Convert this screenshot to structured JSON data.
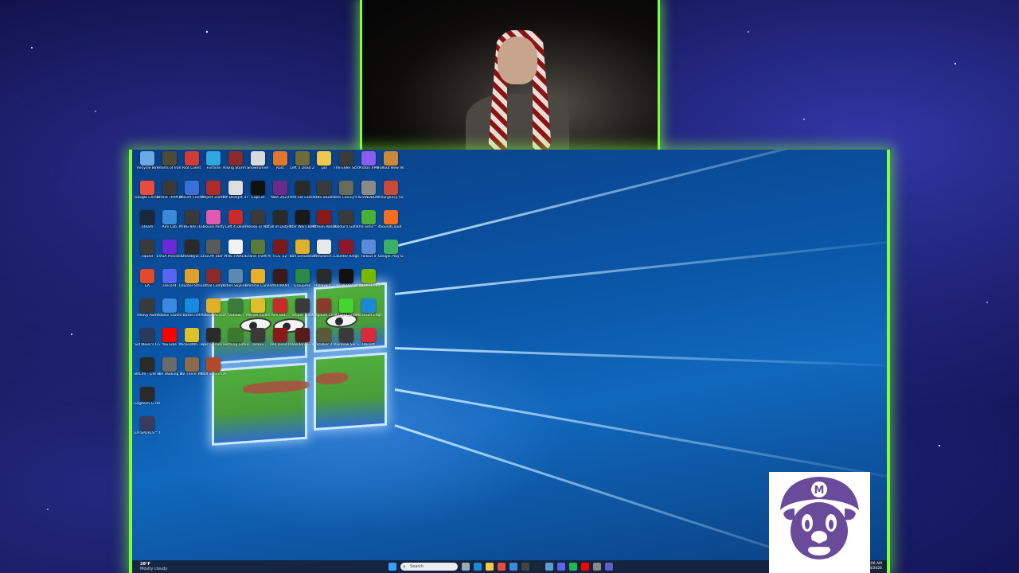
{
  "desktop_icons": [
    {
      "label": "Recycle Bin",
      "color": "#6aa8e6"
    },
    {
      "label": "Hearts of Iron IV",
      "color": "#4d4a3a"
    },
    {
      "label": "Riot Client",
      "color": "#d13b3b"
    },
    {
      "label": "Fortnite",
      "color": "#2ea7e0"
    },
    {
      "label": "Rising Storm 2 Vietnam",
      "color": "#8a2a2a"
    },
    {
      "label": "Snowrunner",
      "color": "#d9d9d9"
    },
    {
      "label": "Rust",
      "color": "#e0772c"
    },
    {
      "label": "Left 4 Dead 2",
      "color": "#6f6a3a"
    },
    {
      "label": "pol",
      "color": "#f0c94a"
    },
    {
      "label": "The Elder Scrolls ...",
      "color": "#3b3b3b"
    },
    {
      "label": "Proton VPN",
      "color": "#8a5cf0"
    },
    {
      "label": "Fallout New Vegas",
      "color": "#c98b3a"
    },
    {
      "label": "Google Chrome",
      "color": "#e74c3c"
    },
    {
      "label": "Grand Theft Auto IV T...",
      "color": "#3a3a3a"
    },
    {
      "label": "Ubisoft Connect",
      "color": "#3a6fd8"
    },
    {
      "label": "Project Zomboid",
      "color": "#b02a2a"
    },
    {
      "label": "HP DeskJet 3700 series",
      "color": "#dddddd"
    },
    {
      "label": "CapCut",
      "color": "#111111"
    },
    {
      "label": "NBA 2K23",
      "color": "#6a2a8a"
    },
    {
      "label": "Hell Let Loose",
      "color": "#2a2a2a"
    },
    {
      "label": "OBS Studio",
      "color": "#3a3a3a"
    },
    {
      "label": "Tom Clancy's Rainbow Si...",
      "color": "#6a6a5a"
    },
    {
      "label": "STANDBOX",
      "color": "#8a8a8a"
    },
    {
      "label": "Insurgency Sandstorm",
      "color": "#c94a3a"
    },
    {
      "label": "Steam",
      "color": "#1b2838"
    },
    {
      "label": "Aim Lab",
      "color": "#3a8ad8"
    },
    {
      "label": "PUBG BATTLEGR...",
      "color": "#3a3a3a"
    },
    {
      "label": "House Party",
      "color": "#e05ab0"
    },
    {
      "label": "Left 4 Dead",
      "color": "#c92a2a"
    },
    {
      "label": "Ready or Not",
      "color": "#3a3a3a"
    },
    {
      "label": "Call of Duty® M...",
      "color": "#2a2a2a"
    },
    {
      "label": "Star Wars Battlefront...",
      "color": "#1a1a1a"
    },
    {
      "label": "Hitman Absolution",
      "color": "#8a1a1a"
    },
    {
      "label": "Baldur's Gate 3",
      "color": "#3a3a3a"
    },
    {
      "label": "The Sims™ 4",
      "color": "#4ab03a"
    },
    {
      "label": "SoundCloud",
      "color": "#f26f23"
    },
    {
      "label": "squad",
      "color": "#3a3a3a"
    },
    {
      "label": "EVGA Precision X1",
      "color": "#6a2ad8"
    },
    {
      "label": "DeadByD...",
      "color": "#2a2a2a"
    },
    {
      "label": "LEGO® Star Wars™ Th...",
      "color": "#5a5a5a"
    },
    {
      "label": "THE FINALS",
      "color": "#f2f2f2"
    },
    {
      "label": "Grand Theft Auto V",
      "color": "#5a7a3a"
    },
    {
      "label": "FCS '22",
      "color": "#7a1a1a"
    },
    {
      "label": "Ball Simulation...",
      "color": "#e0b02a"
    },
    {
      "label": "WeSearch...",
      "color": "#e8e8e8"
    },
    {
      "label": "Counter Kings III",
      "color": "#8a1a2a"
    },
    {
      "label": "Fallout 4",
      "color": "#5a8ad8"
    },
    {
      "label": "Google Play Games",
      "color": "#3ab06a"
    },
    {
      "label": "EA",
      "color": "#e04a2a"
    },
    {
      "label": "Discord",
      "color": "#5865f2"
    },
    {
      "label": "Counter-Stri... Global Offe...",
      "color": "#e0a02a"
    },
    {
      "label": "Lethal Company",
      "color": "#8a2a2a"
    },
    {
      "label": "Cities Skylines",
      "color": "#5a8ab0"
    },
    {
      "label": "Chrome Canary",
      "color": "#e8b02a"
    },
    {
      "label": "VALORANT",
      "color": "#3a1a1a"
    },
    {
      "label": "Groupme",
      "color": "#2a8a4a"
    },
    {
      "label": "Hollowkn...",
      "color": "#2a2a2a"
    },
    {
      "label": "Debell Protocol",
      "color": "#111111"
    },
    {
      "label": "NVIDIA Broadcast",
      "color": "#76b900"
    },
    {
      "label": "Heavy Rain",
      "color": "#3a3a3a"
    },
    {
      "label": "Roblox Studio",
      "color": "#3a8ae0"
    },
    {
      "label": "Battle.net",
      "color": "#1a8ae0"
    },
    {
      "label": "Roblox Account",
      "color": "#e0b02a"
    },
    {
      "label": "Outlaw...",
      "color": "#3a7a3a"
    },
    {
      "label": "Marvel Rivals",
      "color": "#e0c02a"
    },
    {
      "label": "Aim Bot...",
      "color": "#c92a2a"
    },
    {
      "label": "Sniper Elite",
      "color": "#3a3a3a"
    },
    {
      "label": "Kingdom Come Deliver...",
      "color": "#8a3a2a"
    },
    {
      "label": "Razer Cortex",
      "color": "#44d62c"
    },
    {
      "label": "Microsoft Edge",
      "color": "#1a8ad8"
    },
    {
      "label": "Sid Meier's Civilization VI",
      "color": "#2a3a5a"
    },
    {
      "label": "YouTube",
      "color": "#ff0000"
    },
    {
      "label": "WickedWh... VR4k - 14...",
      "color": "#e0c02a"
    },
    {
      "label": "Epic Games Launcher",
      "color": "#2a2a2a"
    },
    {
      "label": "Farming Simulator",
      "color": "#3a7a2a"
    },
    {
      "label": "Tarkov",
      "color": "#3a3a3a"
    },
    {
      "label": "Red Dead II",
      "color": "#8a1a1a"
    },
    {
      "label": "Resident Evil",
      "color": "#5a1a1a"
    },
    {
      "label": "Stalker 2",
      "color": "#5a5a3a"
    },
    {
      "label": "Rainbow Six Siege",
      "color": "#3a3a3a"
    },
    {
      "label": "Ubisoft",
      "color": "#d82a3a"
    },
    {
      "label": "BitLife - Life Simulator",
      "color": "#2a2a2a"
    },
    {
      "label": "The Walking Dead The ...",
      "color": "#6a6a6a"
    },
    {
      "label": "RV There Yet",
      "color": "#8a6a4a"
    },
    {
      "label": "Half Sword Demo",
      "color": "#b04a2a"
    },
    {
      "label": "Logitech G HUB",
      "color": "#2a2a2a"
    },
    {
      "label": "EA SPORTS™ Madden N...",
      "color": "#3a3a5a"
    }
  ],
  "taskbar": {
    "weather_temp": "28°F",
    "weather_cond": "Mostly cloudy",
    "search_placeholder": "Search",
    "time": "12:06 AM",
    "date": "1/8/2026",
    "apps": [
      {
        "name": "windows-start",
        "color": "#3aa0ff"
      },
      {
        "name": "search",
        "color": "#e9eef5"
      },
      {
        "name": "task-view",
        "color": "#9ab"
      },
      {
        "name": "edge",
        "color": "#1a8ad8"
      },
      {
        "name": "file-explorer",
        "color": "#f0c94a"
      },
      {
        "name": "chrome",
        "color": "#e74c3c"
      },
      {
        "name": "store",
        "color": "#3a8ad8"
      },
      {
        "name": "obs",
        "color": "#444444"
      },
      {
        "name": "steam",
        "color": "#1b2838"
      },
      {
        "name": "notepad",
        "color": "#5a9ad8"
      },
      {
        "name": "discord",
        "color": "#5865f2"
      },
      {
        "name": "spotify",
        "color": "#1db954"
      },
      {
        "name": "youtube",
        "color": "#ff0000"
      },
      {
        "name": "settings",
        "color": "#888888"
      },
      {
        "name": "teams",
        "color": "#5b5fc7"
      }
    ]
  },
  "colors": {
    "accent_glow": "#7dff3a",
    "mario_logo": "#6a4a9a"
  }
}
